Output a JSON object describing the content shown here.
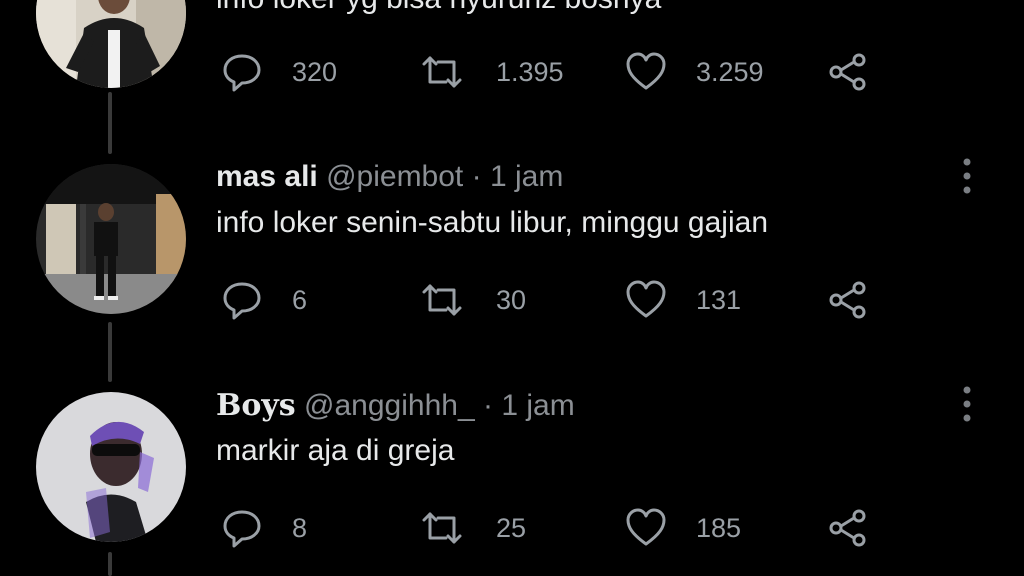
{
  "colors": {
    "background": "#000000",
    "text": "#e7e9ea",
    "muted": "#8b8f94",
    "icon": "#9aa0a6",
    "thread_line": "#3a3a3a"
  },
  "tweets": [
    {
      "text": "info loker yg bisa nyuruhz bosnya",
      "reply_count": "320",
      "retweet_count": "1.395",
      "like_count": "3.259"
    },
    {
      "name": "mas ali",
      "handle": "@piembot",
      "separator": "·",
      "time": "1 jam",
      "text": "info loker senin-sabtu libur, minggu gajian",
      "reply_count": "6",
      "retweet_count": "30",
      "like_count": "131"
    },
    {
      "name": "Boys",
      "handle": "@anggihhh_",
      "separator": "·",
      "time": "1 jam",
      "text": "markir aja di greja",
      "reply_count": "8",
      "retweet_count": "25",
      "like_count": "185"
    }
  ],
  "icons": {
    "reply": "reply-icon",
    "retweet": "retweet-icon",
    "like": "heart-icon",
    "share": "share-icon",
    "more": "more-vertical-icon"
  }
}
